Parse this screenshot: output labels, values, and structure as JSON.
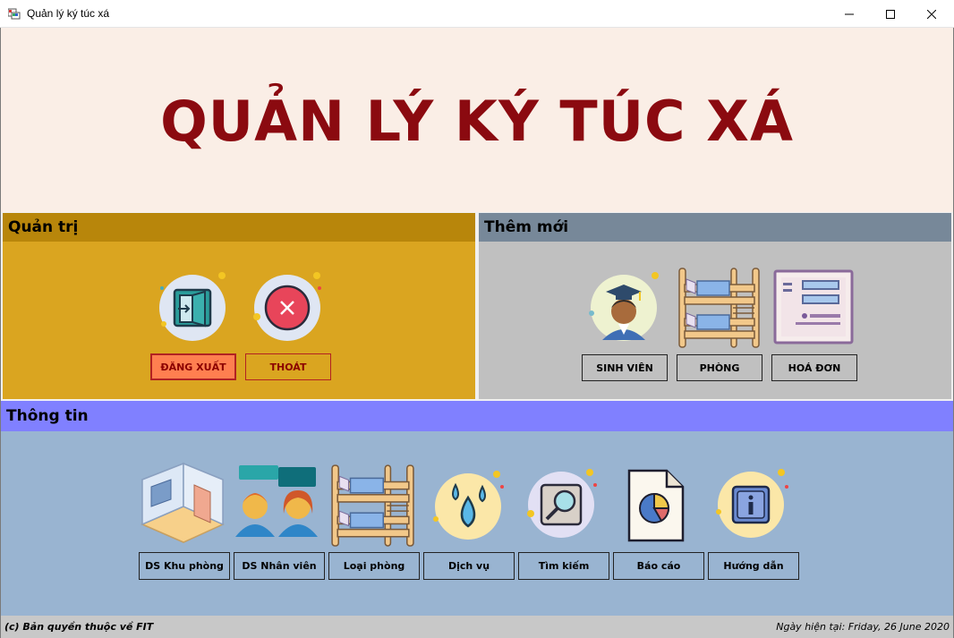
{
  "window": {
    "title": "Quản lý ký túc xá",
    "minimize_glyph": "—",
    "maximize_glyph": "☐",
    "close_glyph": "✕"
  },
  "header": {
    "title": "QUẢN LÝ KÝ TÚC XÁ",
    "background": "#faeee6",
    "title_color": "#8b0a10"
  },
  "quan_tri": {
    "heading": "Quản trị",
    "buttons": [
      {
        "label": "ĐĂNG XUẤT",
        "icon": "logout-door-icon"
      },
      {
        "label": "THOÁT",
        "icon": "exit-x-icon"
      }
    ],
    "colors": {
      "panel": "#daa520",
      "heading": "#b8860b"
    }
  },
  "them_moi": {
    "heading": "Thêm mới",
    "buttons": [
      {
        "label": "SINH VIÊN",
        "icon": "graduate-student-icon"
      },
      {
        "label": "PHÒNG",
        "icon": "bunk-bed-icon"
      },
      {
        "label": "HOÁ ĐƠN",
        "icon": "invoice-icon"
      }
    ],
    "colors": {
      "panel": "#c0c0c0",
      "heading": "#778899"
    }
  },
  "thong_tin": {
    "heading": "Thông tin",
    "buttons": [
      {
        "label": "DS Khu phòng",
        "icon": "room-area-icon"
      },
      {
        "label": "DS Nhân viên",
        "icon": "staff-people-icon"
      },
      {
        "label": "Loại phòng",
        "icon": "bunk-bed-icon"
      },
      {
        "label": "Dịch vụ",
        "icon": "water-drops-icon"
      },
      {
        "label": "Tìm kiếm",
        "icon": "search-magnifier-icon"
      },
      {
        "label": "Báo cáo",
        "icon": "report-pie-icon"
      },
      {
        "label": "Hướng dẫn",
        "icon": "info-icon"
      }
    ],
    "colors": {
      "panel": "#99b4d1",
      "heading": "#8080ff"
    }
  },
  "footer": {
    "copyright": "(c) Bản quyền thuộc về FIT",
    "date": "Ngày hiện tại: Friday, 26 June 2020"
  }
}
